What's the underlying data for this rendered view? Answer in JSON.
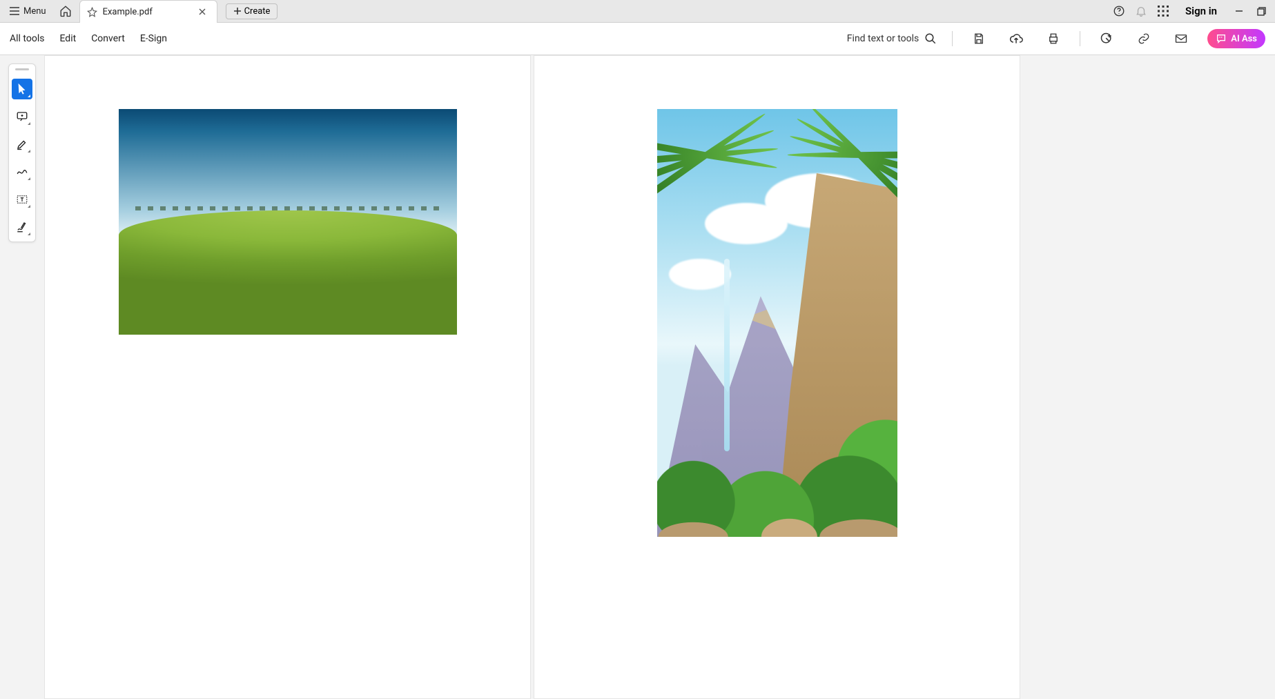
{
  "titlebar": {
    "menu_label": "Menu",
    "tab_filename": "Example.pdf",
    "create_label": "Create",
    "sign_in_label": "Sign in"
  },
  "toolbar": {
    "items": [
      "All tools",
      "Edit",
      "Convert",
      "E-Sign"
    ],
    "find_label": "Find text or tools",
    "ai_label": "AI Ass"
  },
  "palette": {
    "tools": [
      {
        "name": "select-tool",
        "active": true
      },
      {
        "name": "comment-tool",
        "active": false
      },
      {
        "name": "highlight-tool",
        "active": false
      },
      {
        "name": "draw-tool",
        "active": false
      },
      {
        "name": "textbox-tool",
        "active": false
      },
      {
        "name": "fill-sign-tool",
        "active": false
      }
    ]
  },
  "document": {
    "pages": [
      {
        "image": "green-field-landscape",
        "orientation": "landscape"
      },
      {
        "image": "tropical-mountain-illustration",
        "orientation": "portrait"
      }
    ]
  }
}
